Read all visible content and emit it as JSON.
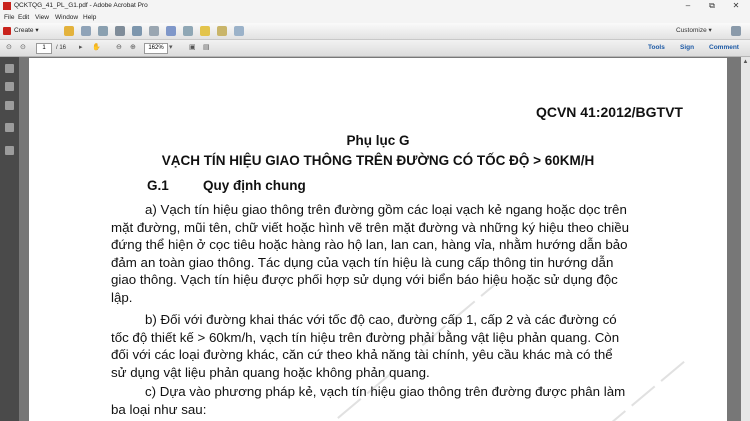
{
  "window": {
    "title": "QCKTQG_41_PL_G1.pdf - Adobe Acrobat Pro",
    "minimize": "–",
    "restore": "⧉",
    "close": "✕"
  },
  "menu": [
    "File",
    "Edit",
    "View",
    "Window",
    "Help"
  ],
  "toolbar": {
    "create_label": "Create",
    "customize_label": "Customize"
  },
  "nav": {
    "page_current": "1",
    "page_total": "/ 16",
    "zoom": "162%",
    "tools": "Tools",
    "sign": "Sign",
    "comment": "Comment"
  },
  "document": {
    "code": "QCVN 41:2012/BGTVT",
    "appendix": "Phụ lục G",
    "heading": "VẠCH TÍN HIỆU GIAO THÔNG TRÊN ĐƯỜNG CÓ TỐC ĐỘ > 60KM/H",
    "section_number": "G.1",
    "section_title": "Quy định chung",
    "para_a": [
      "a) Vạch tín hiệu giao thông trên đường gồm các loại vạch kẻ ngang hoặc dọc trên",
      "mặt đường, mũi tên, chữ viết hoặc hình vẽ trên mặt đường và những ký hiệu theo chiều",
      "đứng thể hiện ở cọc tiêu hoặc hàng rào hộ lan, lan can, hàng vỉa, nhằm hướng dẫn bảo",
      "đảm an toàn giao thông. Tác dụng của vạch tín hiệu là cung cấp thông tin hướng dẫn",
      "giao thông. Vạch tín hiệu được phối hợp sử dụng với biển báo hiệu hoặc sử dụng độc",
      "lập."
    ],
    "para_b": [
      "b) Đối với đường khai thác với tốc độ cao, đường cấp 1, cấp 2 và các đường có",
      "tốc độ thiết kế > 60km/h, vạch tín hiệu trên đường phải bằng vật liệu phản quang. Còn",
      "đối với các loại đường khác, căn cứ theo khả năng tài chính, yêu cầu khác mà có thể",
      "sử dụng vật liệu phản quang hoặc không phản quang."
    ],
    "para_c": [
      "c) Dựa vào phương pháp kẻ, vạch tín hiệu giao thông trên đường được phân làm",
      "ba loại như sau:"
    ]
  }
}
